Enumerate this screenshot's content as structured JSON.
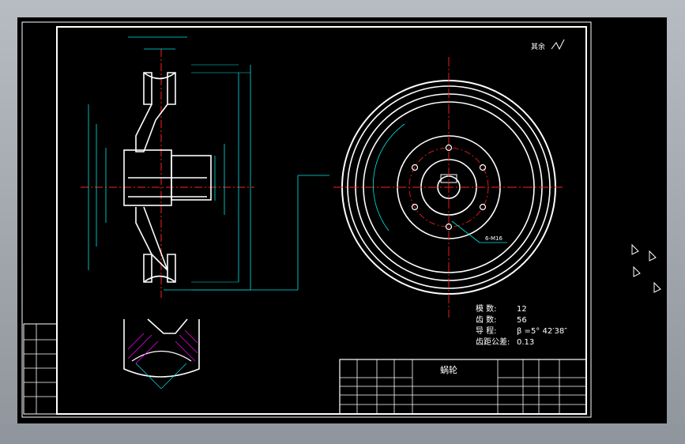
{
  "surface_marks": {
    "rest": "其余"
  },
  "specs": [
    {
      "label": "模   数:",
      "value": "12"
    },
    {
      "label": "齿   数:",
      "value": "56"
    },
    {
      "label": "导   程:",
      "value": "β =5° 42′38″"
    },
    {
      "label": "齿距公差:",
      "value": "0.13"
    }
  ],
  "hole_label": "6-M16",
  "title_block": {
    "part_name": "蜗轮"
  },
  "left_block": {
    "rows": [
      "",
      "",
      "",
      "",
      "",
      ""
    ]
  },
  "colors": {
    "background": "#000000",
    "outline": "#ffffff",
    "dimension": "#00e5e5",
    "centerline": "#ff2020",
    "hatch": "#ff00ff"
  }
}
